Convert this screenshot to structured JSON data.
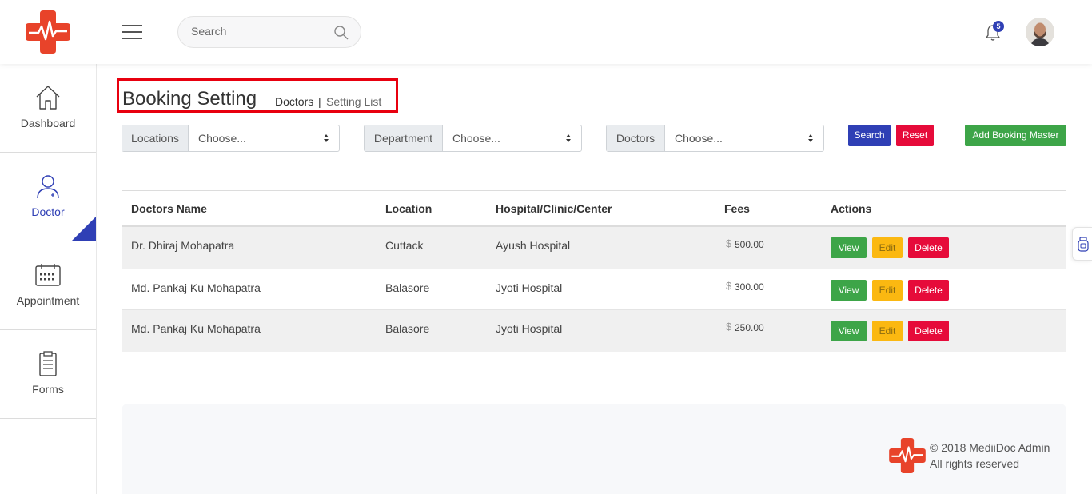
{
  "header": {
    "search_placeholder": "Search",
    "notification_count": "5"
  },
  "sidebar": {
    "items": [
      {
        "label": "Dashboard",
        "icon": "home-icon"
      },
      {
        "label": "Doctor",
        "icon": "doctor-icon",
        "active": true
      },
      {
        "label": "Appointment",
        "icon": "calendar-icon"
      },
      {
        "label": "Forms",
        "icon": "clipboard-icon"
      }
    ]
  },
  "page": {
    "title": "Booking Setting",
    "breadcrumb": [
      "Doctors",
      "Setting List"
    ],
    "breadcrumb_separator": "|"
  },
  "filters": [
    {
      "label": "Locations",
      "value": "Choose..."
    },
    {
      "label": "Department",
      "value": "Choose..."
    },
    {
      "label": "Doctors",
      "value": "Choose..."
    }
  ],
  "buttons": {
    "search": "Search",
    "reset": "Reset",
    "add": "Add Booking Master"
  },
  "table": {
    "headers": [
      "Doctors Name",
      "Location",
      "Hospital/Clinic/Center",
      "Fees",
      "Actions"
    ],
    "currency_symbol": "$",
    "rows": [
      {
        "name": "Dr. Dhiraj Mohapatra",
        "location": "Cuttack",
        "hospital": "Ayush Hospital",
        "fees": "500.00"
      },
      {
        "name": "Md. Pankaj Ku Mohapatra",
        "location": "Balasore",
        "hospital": "Jyoti Hospital",
        "fees": "300.00"
      },
      {
        "name": "Md. Pankaj Ku Mohapatra",
        "location": "Balasore",
        "hospital": "Jyoti Hospital",
        "fees": "250.00"
      }
    ],
    "actions": {
      "view": "View",
      "edit": "Edit",
      "delete": "Delete"
    }
  },
  "footer": {
    "line1": "© 2018 MediiDoc Admin",
    "line2": "All rights reserved"
  },
  "colors": {
    "brand": "#e8432a",
    "primary": "#2f3fb5",
    "success": "#3da548",
    "warning": "#fbb811",
    "danger": "#e60b3a",
    "highlight_border": "#e8000f"
  }
}
